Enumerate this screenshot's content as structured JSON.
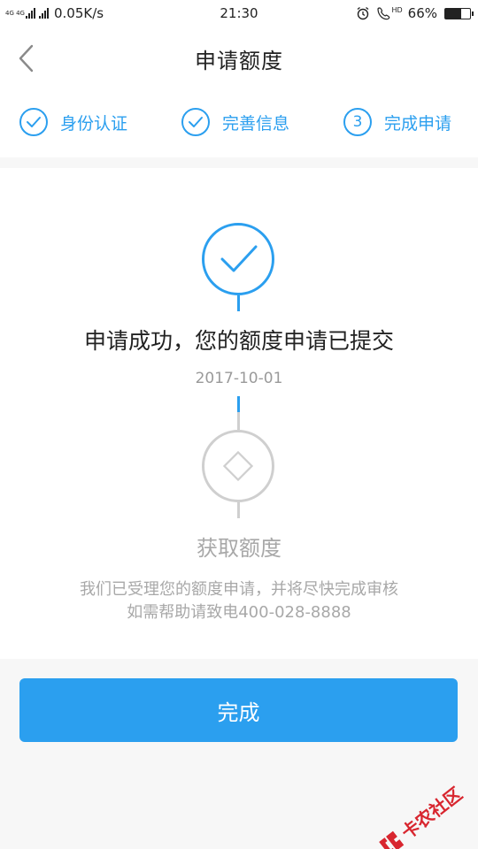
{
  "status_bar": {
    "net_type": "4G 4G",
    "net_speed": "0.05K/s",
    "time": "21:30",
    "hd_label": "HD",
    "battery_percent": "66%",
    "battery_level": 0.66
  },
  "header": {
    "title": "申请额度"
  },
  "steps": [
    {
      "label": "身份认证",
      "state": "done"
    },
    {
      "label": "完善信息",
      "state": "done"
    },
    {
      "label": "完成申请",
      "state": "current",
      "number": "3"
    }
  ],
  "result": {
    "headline": "申请成功，您的额度申请已提交",
    "date": "2017-10-01",
    "pending_title": "获取额度",
    "desc_line1": "我们已受理您的额度申请，并将尽快完成审核",
    "desc_line2": "如需帮助请致电400-028-8888"
  },
  "done_button": {
    "label": "完成"
  },
  "watermark": {
    "text": "卡农社区"
  },
  "colors": {
    "accent": "#2b9fef",
    "muted": "#cfcfcf",
    "watermark": "#d8262f"
  }
}
